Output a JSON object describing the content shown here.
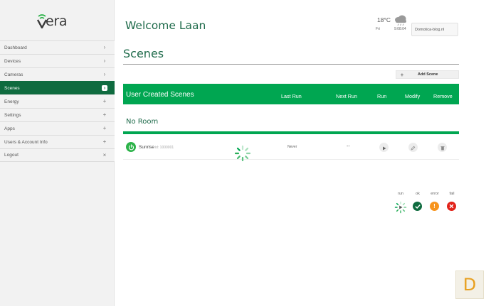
{
  "app": {
    "logo_text": "era"
  },
  "sidebar": {
    "items": [
      {
        "label": "Dashboard",
        "icon": "chevron-right-icon",
        "glyph": "›"
      },
      {
        "label": "Devices",
        "icon": "chevron-right-icon",
        "glyph": "›"
      },
      {
        "label": "Cameras",
        "icon": "chevron-right-icon",
        "glyph": "›"
      },
      {
        "label": "Scenes",
        "icon": "chevron-right-icon",
        "glyph": "›",
        "active": true
      },
      {
        "label": "Energy",
        "icon": "plus-icon",
        "glyph": "+"
      },
      {
        "label": "Settings",
        "icon": "plus-icon",
        "glyph": "+"
      },
      {
        "label": "Apps",
        "icon": "plus-icon",
        "glyph": "+"
      },
      {
        "label": "Users & Account Info",
        "icon": "plus-icon",
        "glyph": "+"
      },
      {
        "label": "Logout",
        "icon": "close-icon",
        "glyph": "×"
      }
    ]
  },
  "header": {
    "welcome": "Welcome Laan",
    "temperature": "18°C",
    "day": "Fri",
    "time": "9:08:04",
    "site": "Domotica-blog.nl",
    "weather_icon": "cloud-rain-icon"
  },
  "main": {
    "title": "Scenes",
    "add_scene_label": "Add Scene",
    "table": {
      "title": "User Created Scenes",
      "columns": {
        "last_run": "Last Run",
        "next_run": "Next Run",
        "run": "Run",
        "modify": "Modify",
        "remove": "Remove"
      }
    },
    "room": "No Room",
    "scenes": [
      {
        "name": "Sunrise",
        "id": "id: 1000001",
        "last_run": "Never",
        "next_run": "--"
      }
    ]
  },
  "legend": {
    "run": "run",
    "ok": "ok",
    "error": "error",
    "fail": "fail"
  },
  "colors": {
    "accent": "#00a651",
    "sidebar_active": "#0f6b3f",
    "error": "#f7941d",
    "fail": "#e2231a",
    "ok": "#0f6b3f"
  },
  "badge": {
    "letter": "D"
  }
}
